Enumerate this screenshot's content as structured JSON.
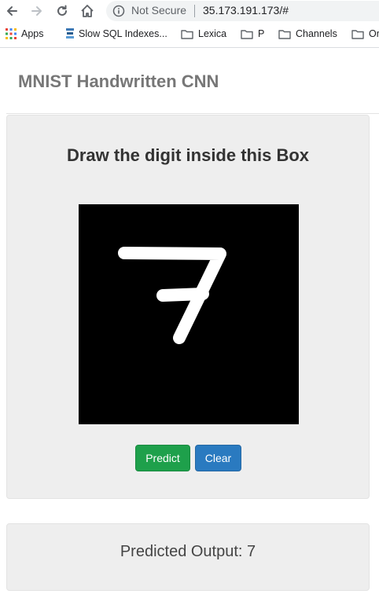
{
  "browser": {
    "security_text": "Not Secure",
    "url": "35.173.191.173/#",
    "bookmarks": [
      {
        "label": "Apps",
        "icon": "apps-grid-icon"
      },
      {
        "label": "Slow SQL Indexes...",
        "icon": "page-icon"
      },
      {
        "label": "Lexica",
        "icon": "folder-icon"
      },
      {
        "label": "P",
        "icon": "folder-icon"
      },
      {
        "label": "Channels",
        "icon": "folder-icon"
      },
      {
        "label": "Or",
        "icon": "folder-icon"
      }
    ]
  },
  "page": {
    "brand": "MNIST Handwritten CNN",
    "heading": "Draw the digit inside this Box",
    "predict_label": "Predict",
    "clear_label": "Clear",
    "result_label": "Predicted Output:",
    "prediction": "7"
  },
  "colors": {
    "predict_button": "#1ea04b",
    "clear_button": "#2a7ac0",
    "canvas_bg": "#000000",
    "stroke": "#ffffff"
  }
}
